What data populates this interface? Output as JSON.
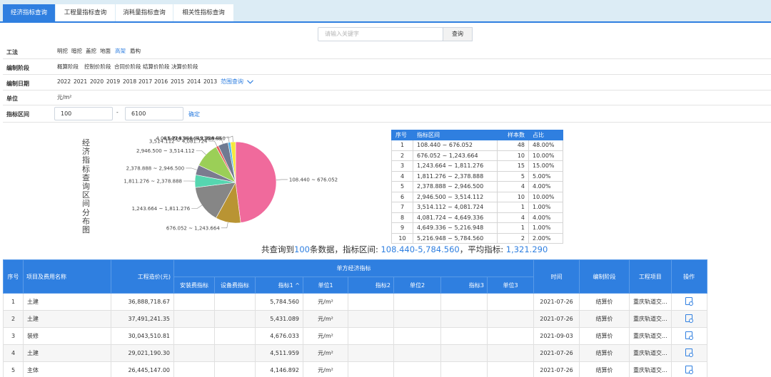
{
  "tabs": [
    "经济指标查询",
    "工程量指标查询",
    "消耗量指标查询",
    "相关性指标查询"
  ],
  "search": {
    "placeholder": "请输入关键字",
    "button": "查询"
  },
  "filters": {
    "method": {
      "label": "工法",
      "options": [
        "明挖",
        "暗挖",
        "盖挖",
        "地面",
        "高架",
        "盾构"
      ],
      "selected": "高架"
    },
    "stage": {
      "label": "编制阶段",
      "options": [
        "概算阶段",
        "控制价阶段",
        "合同价阶段",
        "结算价阶段",
        "决算价阶段"
      ]
    },
    "date": {
      "label": "编制日期",
      "options": [
        "2022",
        "2021",
        "2020",
        "2019",
        "2018",
        "2017",
        "2016",
        "2015",
        "2014",
        "2013"
      ],
      "range_link": "范围查询"
    },
    "unit": {
      "label": "单位",
      "value": "元/m²"
    },
    "range": {
      "label": "指标区间",
      "min": "100",
      "sep": "-",
      "max": "6100",
      "confirm": "确定"
    }
  },
  "chart_data": {
    "type": "pie",
    "title": "经济指标查询区间分布图",
    "slices": [
      {
        "label": "108.440 ~ 676.052",
        "value": 48,
        "color": "#f06a9c"
      },
      {
        "label": "676.052 ~ 1,243.664",
        "value": 10,
        "color": "#b99433"
      },
      {
        "label": "1,243.664 ~ 1,811.276",
        "value": 15,
        "color": "#868686"
      },
      {
        "label": "1,811.276 ~ 2,378.888",
        "value": 5,
        "color": "#56d6b0"
      },
      {
        "label": "2,378.888 ~ 2,946.500",
        "value": 4,
        "color": "#7b7b8f"
      },
      {
        "label": "2,946.500 ~ 3,514.112",
        "value": 10,
        "color": "#9bcf57"
      },
      {
        "label": "3,514.112 ~ 4,081.724",
        "value": 1,
        "color": "#e35d5d"
      },
      {
        "label": "4,081.724 ~ 4,649.336",
        "value": 4,
        "color": "#6f7a92"
      },
      {
        "label": "4,649.336 ~ 5,216.948",
        "value": 1,
        "color": "#4fb3e8"
      },
      {
        "label": "5,216.948 ~ 5,784.560",
        "value": 2,
        "color": "#f5e83c"
      }
    ]
  },
  "stats_table": {
    "headers": [
      "序号",
      "指标区间",
      "样本数",
      "占比"
    ],
    "rows": [
      [
        "1",
        "108.440 ~ 676.052",
        "48",
        "48.00%"
      ],
      [
        "2",
        "676.052 ~ 1,243.664",
        "10",
        "10.00%"
      ],
      [
        "3",
        "1,243.664 ~ 1,811.276",
        "15",
        "15.00%"
      ],
      [
        "4",
        "1,811.276 ~ 2,378.888",
        "5",
        "5.00%"
      ],
      [
        "5",
        "2,378.888 ~ 2,946.500",
        "4",
        "4.00%"
      ],
      [
        "6",
        "2,946.500 ~ 3,514.112",
        "10",
        "10.00%"
      ],
      [
        "7",
        "3,514.112 ~ 4,081.724",
        "1",
        "1.00%"
      ],
      [
        "8",
        "4,081.724 ~ 4,649.336",
        "4",
        "4.00%"
      ],
      [
        "9",
        "4,649.336 ~ 5,216.948",
        "1",
        "1.00%"
      ],
      [
        "10",
        "5,216.948 ~ 5,784.560",
        "2",
        "2.00%"
      ]
    ]
  },
  "summary": {
    "prefix": "共查询到",
    "count": "100",
    "mid": "条数据，指标区间: ",
    "range": "108.440-5,784.560",
    "mid2": "，平均指标: ",
    "avg": "1,321.290"
  },
  "main_table": {
    "headers": {
      "index": "序号",
      "name": "项目及费用名称",
      "cost": "工程造价(元)",
      "group": "单方经济指标",
      "install": "安装费指标",
      "equip": "设备费指标",
      "idx1": "指标1",
      "sort_arrow": "^",
      "unit1": "单位1",
      "idx2": "指标2",
      "unit2": "单位2",
      "idx3": "指标3",
      "unit3": "单位3",
      "time": "时间",
      "stage": "编制阶段",
      "project": "工程项目",
      "op": "操作"
    },
    "rows": [
      {
        "no": "1",
        "name": "土建",
        "cost": "36,888,718.67",
        "install": "",
        "equip": "",
        "idx1": "5,784.560",
        "unit1": "元/m²",
        "idx2": "",
        "unit2": "",
        "idx3": "",
        "unit3": "",
        "time": "2021-07-26",
        "stage": "结算价",
        "project": "重庆轨道交..."
      },
      {
        "no": "2",
        "name": "土建",
        "cost": "37,491,241.35",
        "install": "",
        "equip": "",
        "idx1": "5,431.089",
        "unit1": "元/m²",
        "idx2": "",
        "unit2": "",
        "idx3": "",
        "unit3": "",
        "time": "2021-07-26",
        "stage": "结算价",
        "project": "重庆轨道交..."
      },
      {
        "no": "3",
        "name": "装修",
        "cost": "30,043,510.81",
        "install": "",
        "equip": "",
        "idx1": "4,676.033",
        "unit1": "元/m²",
        "idx2": "",
        "unit2": "",
        "idx3": "",
        "unit3": "",
        "time": "2021-09-03",
        "stage": "结算价",
        "project": "重庆轨道交..."
      },
      {
        "no": "4",
        "name": "土建",
        "cost": "29,021,190.30",
        "install": "",
        "equip": "",
        "idx1": "4,511.959",
        "unit1": "元/m²",
        "idx2": "",
        "unit2": "",
        "idx3": "",
        "unit3": "",
        "time": "2021-07-26",
        "stage": "结算价",
        "project": "重庆轨道交..."
      },
      {
        "no": "5",
        "name": "主体",
        "cost": "26,445,147.00",
        "install": "",
        "equip": "",
        "idx1": "4,146.892",
        "unit1": "元/m²",
        "idx2": "",
        "unit2": "",
        "idx3": "",
        "unit3": "",
        "time": "2021-07-26",
        "stage": "结算价",
        "project": "重庆轨道交..."
      }
    ]
  }
}
